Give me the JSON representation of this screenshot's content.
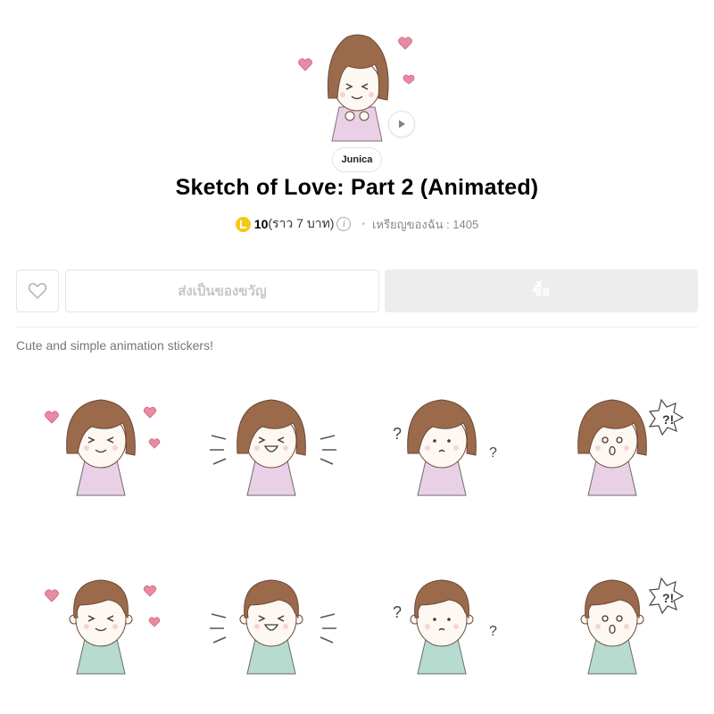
{
  "author": "Junica",
  "title": "Sketch of Love: Part 2 (Animated)",
  "price": {
    "amount": "10",
    "approx": "(ราว 7 บาท)",
    "info_icon": "info-icon",
    "my_coins": "เหรียญของฉัน : 1405"
  },
  "actions": {
    "favorite_icon": "heart-outline-icon",
    "gift_label": "ส่งเป็นของขวัญ",
    "buy_label": "ซื้อ"
  },
  "description": "Cute and simple animation stickers!",
  "colors": {
    "coin": "#f5c814",
    "hair": "#8a5a3c",
    "heart": "#e98aa3",
    "girl_dress": "#ead0e6",
    "boy_shirt": "#b7dccf",
    "disabled_button": "#ededed"
  },
  "stickers": [
    {
      "name": "girl-love",
      "character": "girl",
      "expression": "happy-closed-eyes",
      "effect": "hearts"
    },
    {
      "name": "girl-laugh",
      "character": "girl",
      "expression": "laugh",
      "effect": "lines"
    },
    {
      "name": "girl-confused",
      "character": "girl",
      "expression": "thinking",
      "effect": "question"
    },
    {
      "name": "girl-shock",
      "character": "girl",
      "expression": "surprised",
      "effect": "exclaim"
    },
    {
      "name": "boy-love",
      "character": "boy",
      "expression": "happy-closed-eyes",
      "effect": "hearts"
    },
    {
      "name": "boy-laugh",
      "character": "boy",
      "expression": "laugh",
      "effect": "lines"
    },
    {
      "name": "boy-confused",
      "character": "boy",
      "expression": "thinking",
      "effect": "question"
    },
    {
      "name": "boy-shock",
      "character": "boy",
      "expression": "surprised",
      "effect": "exclaim"
    }
  ]
}
